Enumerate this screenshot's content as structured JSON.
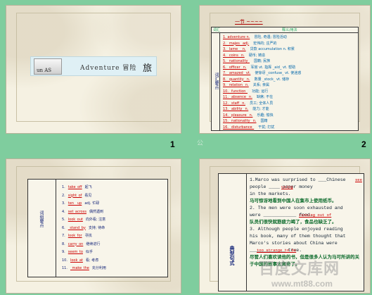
{
  "pages": {
    "num1": "1",
    "num2": "2"
  },
  "slide1": {
    "thumb_text": "un AS",
    "title": "Adventure 冒险",
    "mark": "旅"
  },
  "slide2": {
    "header": "一节 ~~~~",
    "col_a": "词汇",
    "col_b": "释义/用法",
    "side_label": "词汇要点",
    "rows": [
      {
        "word": "1. adventure n.",
        "meaning": "冒险, 奇遇; 冒险活动"
      },
      {
        "word": "2. _majes_ adj.",
        "meaning": "宏伟的; 庄严的"
      },
      {
        "word": "3. _lame__ n.",
        "meaning": "贷款 accumulation n. 积累"
      },
      {
        "word": "4. _coins_ n.",
        "meaning": "硬币; 铸造"
      },
      {
        "word": "5. _nationality_",
        "meaning": "国籍; 民族"
      },
      {
        "word": "6. _officer_ n.",
        "meaning": "军官 vt. 指挥 _aid_ vt. 帮助"
      },
      {
        "word": "7. _amazed_ vt.",
        "meaning": "使惊讶 _confuse_ vt. 使迷惑"
      },
      {
        "word": "8. _quantity_ n.",
        "meaning": "数量 _stock_ vt. 储存"
      },
      {
        "word": "9. _relation_ n.",
        "meaning": "关系; 亲属"
      },
      {
        "word": "10. _function_",
        "meaning": "功能; 运行"
      },
      {
        "word": "11. _absence_ n.",
        "meaning": "缺席; 不在"
      },
      {
        "word": "12. _staff_ n.",
        "meaning": "员工; 全体人员"
      },
      {
        "word": "13. _ability_ n.",
        "meaning": "能力; 才能"
      },
      {
        "word": "14. _pleasure_ n.",
        "meaning": "乐趣; 愉快"
      },
      {
        "word": "15. _nationality_ n.",
        "meaning": "国籍"
      },
      {
        "word": "16. _disturbance_",
        "meaning": "干扰; 打扰"
      }
    ]
  },
  "watermark_small": "公",
  "slide3": {
    "side_label": "词组要点",
    "rows": [
      {
        "num": "1.",
        "u": "take_off",
        "rest": "起飞"
      },
      {
        "num": "2.",
        "u": "sight_of",
        "rest": "看见"
      },
      {
        "num": "3.",
        "u": "ten__up",
        "rest": "adj. 忙碌"
      },
      {
        "num": "4.",
        "u": "set_across",
        "rest": "偶然遇到"
      },
      {
        "num": "5.",
        "u": "look_out",
        "rest": "向外看; 注意"
      },
      {
        "num": "6.",
        "u": "_stand_by",
        "rest": "支持; 待命"
      },
      {
        "num": "7.",
        "u": "look_for",
        "rest": "寻找"
      },
      {
        "num": "8.",
        "u": "carry_on",
        "rest": "继续进行"
      },
      {
        "num": "9.",
        "u": "seem_to",
        "rest": "似乎"
      },
      {
        "num": "10.",
        "u": "look_at",
        "rest": "看; 考虑"
      },
      {
        "num": "11.",
        "u": "_make_the",
        "rest": "充分利用"
      }
    ]
  },
  "slide4": {
    "side_label": "典型句式",
    "lines": [
      {
        "type": "en",
        "text": "1.Marco was surprised to ___Chinese"
      },
      {
        "type": "en",
        "text": "people ____ paper money"
      },
      {
        "type": "en",
        "text": "in the markets."
      },
      {
        "type": "cn",
        "text": "马可惊讶地看到中国人在集市上使用纸币。"
      },
      {
        "type": "en",
        "text": "2. The men were soon exhausted and"
      },
      {
        "type": "en",
        "text": "were ____________ food."
      },
      {
        "type": "cn",
        "text": "队员们很快就筋疲力竭了，食品也缺乏了。"
      },
      {
        "type": "en",
        "text": "3. Although people enjoyed reading"
      },
      {
        "type": "en",
        "text": "his book, many of them thought that"
      },
      {
        "type": "en",
        "text": "Marco's stories about China were"
      },
      {
        "type": "en",
        "text": "_____________ true."
      },
      {
        "type": "cn",
        "text": "尽管人们喜欢读他的书，但是很多人认为马可所讲的关于中国的故事太离奇了。"
      }
    ],
    "answers": {
      "a1": "see",
      "a2": "using",
      "a3": "running out of",
      "a4": "too strange to be"
    }
  },
  "logo_watermark": "百度文库网",
  "logo_watermark_url": "www.mt88.com"
}
